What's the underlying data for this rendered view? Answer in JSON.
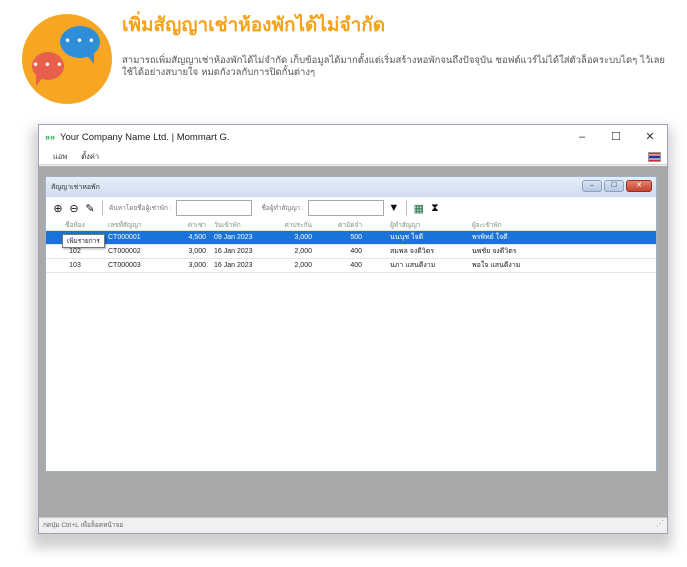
{
  "promo": {
    "title": "เพิ่มสัญญาเช่าห้องพักได้ไม่จำกัด",
    "description": "สามารถเพิ่มสัญญาเช่าห้องพักได้ไม่จำกัด เก็บข้อมูลได้มากตั้งแต่เริ่มสร้างหอพักจนถึงปัจจุบัน ซอฟต์แวร์ไม่ได้ใส่ตัวล็อคระบบไดๆ ไว้เลย ใช้ได้อย่างสบายใจ หมดกังวลกับการปิดกั้นต่างๆ"
  },
  "window": {
    "app_logo": "»»",
    "title": "Your Company Name Ltd. | Mommart G.",
    "minimize": "–",
    "maximize": "☐",
    "close": "✕"
  },
  "menu": {
    "items": [
      {
        "label": "แอพ"
      },
      {
        "label": "ตั้งค่า"
      }
    ]
  },
  "child": {
    "title": "สัญญาเช่าหอพัก",
    "minimize": "–",
    "maximize": "☐",
    "close": "✕"
  },
  "toolbar": {
    "search_room_label": "ค้นหาโดยชื่อผู้เช่าพัก :",
    "search_room_value": "",
    "search_contract_label": "ชื่อผู้ทำสัญญา :",
    "search_contract_value": "",
    "tooltip": "เพิ่มรายการ"
  },
  "table": {
    "headers": [
      "ชื่อห้อง",
      "เลขที่สัญญา",
      "ค่าเช่า",
      "วันเข้าพัก",
      "ค่าประกัน",
      "ค่ามัดจำ",
      "ผู้ทำสัญญา",
      "ผู้จะเข้าพัก"
    ],
    "rows": [
      {
        "room": "101",
        "contract": "CT000001",
        "rent": "4,500",
        "date": "09 Jan 2023",
        "deposit": "3,000",
        "advance": "500",
        "signer": "นนนุช ใจดี",
        "tenant": "พรพิทย์ ใจดี",
        "selected": true
      },
      {
        "room": "102",
        "contract": "CT000002",
        "rent": "3,000",
        "date": "16 Jan 2023",
        "deposit": "2,000",
        "advance": "400",
        "signer": "สมพล จงดีวิตร",
        "tenant": "นพชัย จงดีวิตร",
        "selected": false
      },
      {
        "room": "103",
        "contract": "CT000003",
        "rent": "3,000",
        "date": "16 Jan 2023",
        "deposit": "2,000",
        "advance": "400",
        "signer": "นภา แสนดีงาม",
        "tenant": "พอใจ แสนดีงาม",
        "selected": false
      }
    ]
  },
  "status": {
    "text": "กดปุ่ม Ctrl+L เพื่อล็อคหน้าจอ"
  },
  "colors": {
    "accent": "#f5a21b",
    "selection": "#1a73d9"
  }
}
